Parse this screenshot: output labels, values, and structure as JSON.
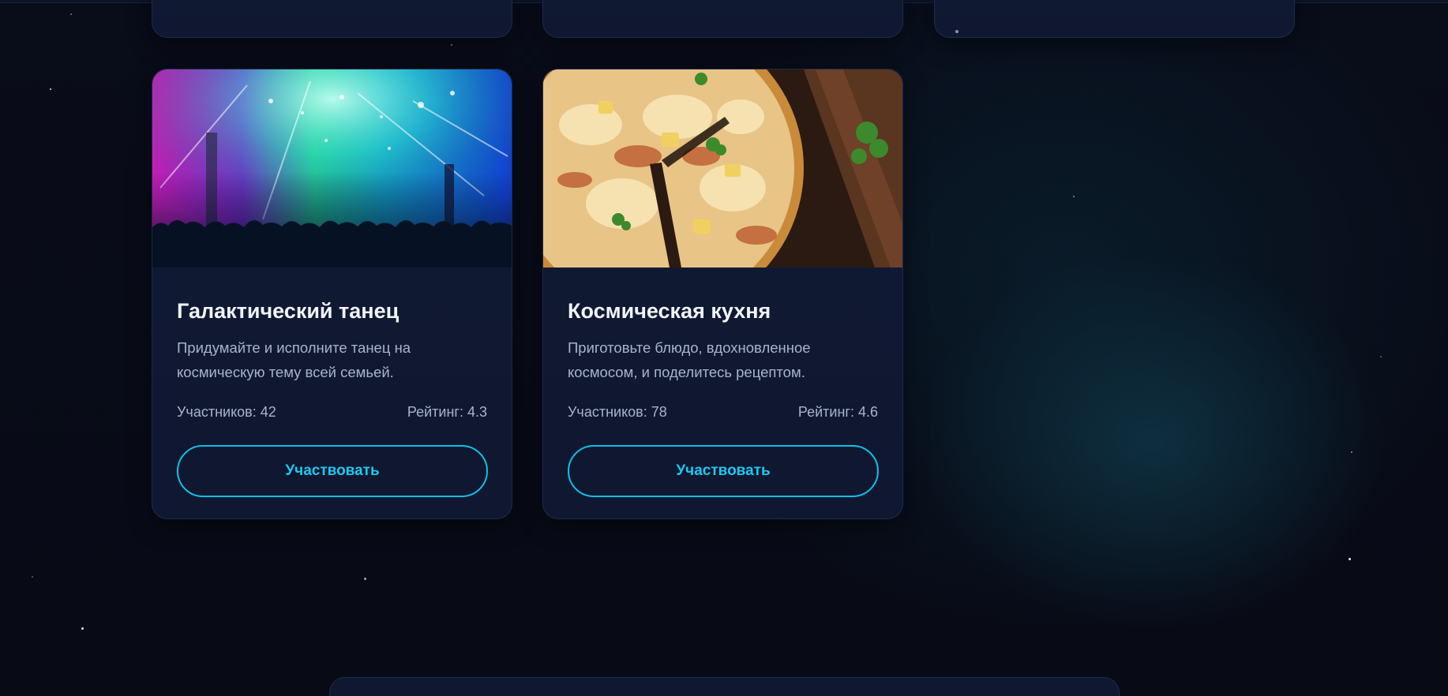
{
  "cards": [
    {
      "title": "Галактический танец",
      "description": "Придумайте и исполните танец на космическую тему всей семьей.",
      "participants": "Участников: 42",
      "rating": "Рейтинг: 4.3",
      "button": "Участвовать",
      "image": "concert-stage-photo"
    },
    {
      "title": "Космическая кухня",
      "description": "Приготовьте блюдо, вдохновленное космосом, и поделитесь рецептом.",
      "participants": "Участников: 78",
      "rating": "Рейтинг: 4.6",
      "button": "Участвовать",
      "image": "pizza-photo"
    }
  ],
  "colors": {
    "background": "#080b17",
    "card": "#111a33",
    "accent": "#12bde6",
    "title": "#f2f5ff",
    "text": "#a9b3cc"
  }
}
